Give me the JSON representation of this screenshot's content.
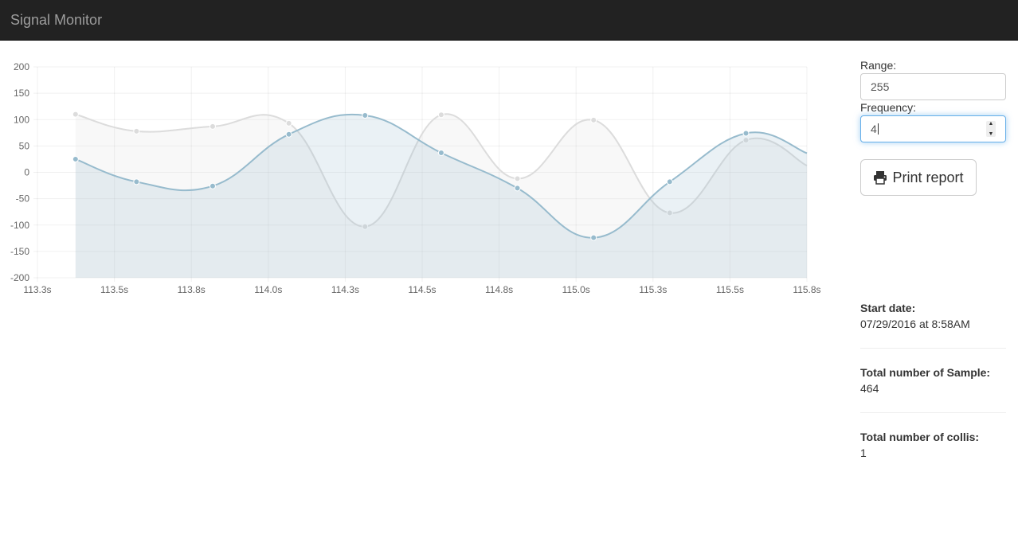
{
  "app": {
    "title": "Signal Monitor"
  },
  "controls": {
    "range_label": "Range:",
    "range_value": "255",
    "frequency_label": "Frequency:",
    "frequency_value": "4",
    "print_label": "Print report"
  },
  "info": {
    "start_date_label": "Start date:",
    "start_date_value": "07/29/2016 at 8:58AM",
    "samples_label": "Total number of Sample:",
    "samples_value": "464",
    "collis_label": "Total number of collis:",
    "collis_value": "1"
  },
  "icons": {
    "print": "printer-icon"
  },
  "chart_data": {
    "type": "area",
    "x_tick_labels": [
      "113.3s",
      "113.5s",
      "113.8s",
      "114.0s",
      "114.3s",
      "114.5s",
      "114.8s",
      "115.0s",
      "115.3s",
      "115.5s",
      "115.8s"
    ],
    "y_tick_labels": [
      "200",
      "150",
      "100",
      "50",
      "0",
      "-50",
      "-100",
      "-150",
      "-200"
    ],
    "ylim": [
      -200,
      200
    ],
    "grid": true,
    "series": [
      {
        "color": "#dcdcdc",
        "fill": "rgba(220,220,220,0.2)",
        "x": [
          113.4,
          113.6,
          113.85,
          114.1,
          114.35,
          114.6,
          114.85,
          115.1,
          115.35,
          115.6
        ],
        "values": [
          110,
          78,
          87,
          93,
          -103,
          109,
          -12,
          99,
          -77,
          61
        ]
      },
      {
        "color": "#97bbcd",
        "fill": "rgba(151,187,205,0.2)",
        "x": [
          113.4,
          113.6,
          113.85,
          114.1,
          114.35,
          114.6,
          114.85,
          115.1,
          115.35,
          115.6
        ],
        "values": [
          25,
          -18,
          -26,
          72,
          108,
          37,
          -30,
          -124,
          -18,
          74
        ]
      }
    ]
  }
}
